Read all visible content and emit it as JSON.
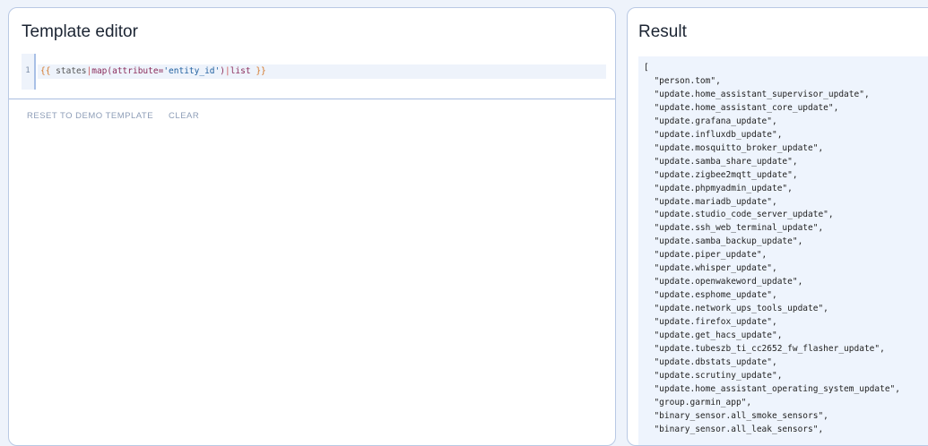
{
  "editor": {
    "title": "Template editor",
    "line_number": "1",
    "tokens": {
      "open": "{{",
      "states": " states",
      "pipe1": "|",
      "map": "map(attribute=",
      "str": "'entity_id'",
      "close_paren": ")",
      "pipe2": "|",
      "list": "list",
      "end": " }}"
    },
    "reset_label": "Reset to demo template",
    "clear_label": "Clear"
  },
  "result": {
    "title": "Result",
    "open_bracket": "[",
    "items": [
      "person.tom",
      "update.home_assistant_supervisor_update",
      "update.home_assistant_core_update",
      "update.grafana_update",
      "update.influxdb_update",
      "update.mosquitto_broker_update",
      "update.samba_share_update",
      "update.zigbee2mqtt_update",
      "update.phpmyadmin_update",
      "update.mariadb_update",
      "update.studio_code_server_update",
      "update.ssh_web_terminal_update",
      "update.samba_backup_update",
      "update.piper_update",
      "update.whisper_update",
      "update.openwakeword_update",
      "update.esphome_update",
      "update.network_ups_tools_update",
      "update.firefox_update",
      "update.get_hacs_update",
      "update.tubeszb_ti_cc2652_fw_flasher_update",
      "update.dbstats_update",
      "update.scrutiny_update",
      "update.home_assistant_operating_system_update",
      "group.garmin_app",
      "binary_sensor.all_smoke_sensors",
      "binary_sensor.all_leak_sensors"
    ]
  }
}
